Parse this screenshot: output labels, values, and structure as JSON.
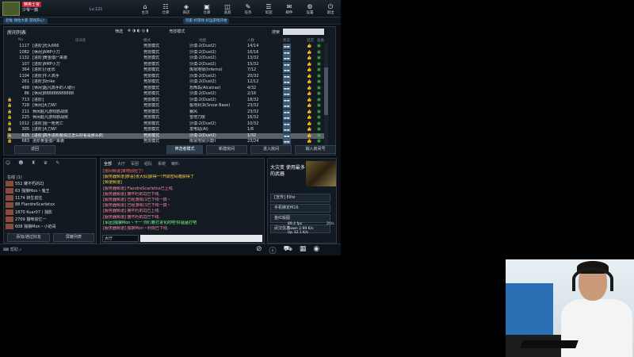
{
  "topbar": {
    "rank_badge": "精英士官",
    "player_name": "少爷一搞",
    "level": "Lv.121"
  },
  "nav": [
    {
      "icon": "home-icon",
      "glyph": "⌂",
      "label": "主页"
    },
    {
      "icon": "shop-icon",
      "glyph": "☷",
      "label": "仓库"
    },
    {
      "icon": "store-icon",
      "glyph": "◈",
      "label": "商店"
    },
    {
      "icon": "depot-icon",
      "glyph": "▣",
      "label": "仓库"
    },
    {
      "icon": "package-icon",
      "glyph": "◫",
      "label": "道具"
    },
    {
      "icon": "task-icon",
      "glyph": "✎",
      "label": "任务"
    },
    {
      "icon": "team-icon",
      "glyph": "☰",
      "label": "军团"
    },
    {
      "icon": "mail-icon",
      "glyph": "✉",
      "label": "邮件"
    },
    {
      "icon": "settings-icon",
      "glyph": "⚙",
      "label": "设置"
    },
    {
      "icon": "exit-icon",
      "glyph": "⏻",
      "label": "退出"
    }
  ],
  "ticker": [
    "老板 保佑大家 游戏开心!",
    "玩家 好游戏 好运游戏开始"
  ],
  "room_panel": {
    "title": "房间列表",
    "filter_label": "筛选",
    "mode_label": "竞技模式",
    "search_label": "搜索",
    "search_placeholder": "",
    "columns": [
      "No",
      "房间名",
      "模式",
      "地图",
      "人数",
      "状态",
      "延迟",
      "准备"
    ],
    "rows": [
      {
        "no": "1117",
        "name": "[进阶]光头666",
        "mode": "竞技模式",
        "map": "沙漠-2(Dust2)",
        "count": "14/14",
        "lock": false,
        "sel": false
      },
      {
        "no": "1082",
        "name": "[休闲]AMP小刀",
        "mode": "竞技模式",
        "map": "沙漠-2(Dust2)",
        "count": "16/16",
        "lock": false,
        "sel": false
      },
      {
        "no": "1132",
        "name": "[进阶]黄金僵尸来袭",
        "mode": "竞技模式",
        "map": "沙漠-2(Dust2)",
        "count": "13/32",
        "lock": false,
        "sel": false
      },
      {
        "no": "107",
        "name": "[进阶]AMP小刀",
        "mode": "竞技模式",
        "map": "沙漠-2(Dust2)",
        "count": "15/32",
        "lock": false,
        "sel": false
      },
      {
        "no": "364",
        "name": "[进阶]小团长",
        "mode": "竞技模式",
        "map": "炼狱地狱(Inferno)",
        "count": "7/12",
        "lock": false,
        "sel": false
      },
      {
        "no": "1104",
        "name": "[进阶]牛人高手",
        "mode": "竞技模式",
        "map": "沙漠-2(Dust2)",
        "count": "20/32",
        "lock": false,
        "sel": false
      },
      {
        "no": "261",
        "name": "[进阶]Strike",
        "mode": "竞技模式",
        "map": "沙漠-2(Dust2)",
        "count": "12/12",
        "lock": false,
        "sel": false
      },
      {
        "no": "488",
        "name": "[休闲]超凡高手的人缝行",
        "mode": "竞技模式",
        "map": "恐怖岛(Alcatraz)",
        "count": "4/32",
        "lock": false,
        "sel": false
      },
      {
        "no": "86",
        "name": "[休闲]888888888888",
        "mode": "竞技模式",
        "map": "沙漠-2(Dust2)",
        "count": "2/16",
        "lock": false,
        "sel": false
      },
      {
        "no": "713",
        "name": "[进阶]",
        "mode": "竞技模式",
        "map": "沙漠-2(Dust2)",
        "count": "18/32",
        "lock": true,
        "sel": false
      },
      {
        "no": "728",
        "name": "[休闲]大刀W!",
        "mode": "竞技模式",
        "map": "极地对决(Snow Base)",
        "count": "23/32",
        "lock": true,
        "sel": false
      },
      {
        "no": "211",
        "name": "休闲超凡游戏剧战房",
        "mode": "竞技模式",
        "map": "暴风",
        "count": "23/32",
        "lock": true,
        "sel": false
      },
      {
        "no": "225",
        "name": "休闲超凡游戏剧战房",
        "mode": "竞技模式",
        "map": "雪地刀房",
        "count": "16/32",
        "lock": true,
        "sel": false
      },
      {
        "no": "1012",
        "name": "[进阶]狙一枪死亡",
        "mode": "竞技模式",
        "map": "沙漠-2(Dust2)",
        "count": "10/32",
        "lock": true,
        "sel": false
      },
      {
        "no": "305",
        "name": "[进阶]大刀W!",
        "mode": "竞技模式",
        "map": "发电站(AI)",
        "count": "1/6",
        "lock": true,
        "sel": false
      },
      {
        "no": "635",
        "name": "[进阶]高手进阶都说过怎么好看是那么的",
        "mode": "竞技模式",
        "map": "沙漠-2(Dust2)",
        "count": "1/32",
        "lock": true,
        "sel": true
      },
      {
        "no": "683",
        "name": "进阶黄金僵尸来袭",
        "mode": "竞技模式",
        "map": "炼狱地狱沙漠II",
        "count": "23/24",
        "lock": true,
        "sel": false
      }
    ]
  },
  "buttons": {
    "back": "返回",
    "filter_mode": "筛选者模式",
    "create_room": "新建房间",
    "enter_room": "进入房间",
    "enter_by_number": "输入房间号"
  },
  "friends": {
    "online_label": "在线 (1)",
    "add_button": "添加/通过好友",
    "room_list_button": "屏蔽列表",
    "items": [
      {
        "level": "552",
        "name": "耀不朽的ZJ"
      },
      {
        "level": "63",
        "name": "独狼Mon丶鬼王"
      },
      {
        "level": "1174",
        "name": "转生前往"
      },
      {
        "level": "88",
        "name": "FlandreScarletxx"
      },
      {
        "level": "1870",
        "name": "Kuar07丨独影"
      },
      {
        "level": "2709",
        "name": "猫咪追忆一"
      },
      {
        "level": "608",
        "name": "独狼Mon丶小焰哥"
      }
    ]
  },
  "chat": {
    "tabs": [
      "全部",
      "大厅",
      "军团",
      "组队",
      "系统",
      "喇叭"
    ],
    "active_tab": "全部",
    "lines": [
      {
        "color": "c-red",
        "text": "[房间频道]来吧别扭了!"
      },
      {
        "color": "c-yel",
        "text": "[服务器频道]恭喜[张大仙]获得一!开启密码箱获得了"
      },
      {
        "color": "c-yel",
        "text": "[频道频道]"
      },
      {
        "color": "c-pink",
        "text": "[服务器频道] FlandreScarletxx已上线."
      },
      {
        "color": "c-pink",
        "text": "[服务器频道] 拥不朽的ZJ已下线."
      },
      {
        "color": "c-pink",
        "text": "[服务器频道] 已经游戏(1已下线一搞丶"
      },
      {
        "color": "c-pink",
        "text": "[服务器频道] 已经游戏(1已下线一搞丶"
      },
      {
        "color": "c-pink",
        "text": "[服务器频道] 拥不朽的ZJ已上线."
      },
      {
        "color": "c-pink",
        "text": "[服务器频道] 拥不朽的ZJ已下线."
      },
      {
        "color": "c-grn",
        "text": "[军团]独狼Mon丶十一 你们着打进化的吧!好猛猛打吧"
      },
      {
        "color": "c-pink",
        "text": "[服务器频道] 独狼Mon丶利剑已下线."
      }
    ],
    "channel": "大厅",
    "input_value": ""
  },
  "side_panel": {
    "ad_text": "大灾变 使用最多的武器",
    "buttons": [
      "[宣传] Elite",
      "手机绑定M16",
      "金红版图",
      "武汉信息"
    ],
    "fps": "89.4 fps",
    "ping": "20/s",
    "down": "Down 2.99 K/s",
    "up": "Up 32.1 K/s"
  },
  "bottombar": {
    "help": "帮助"
  }
}
